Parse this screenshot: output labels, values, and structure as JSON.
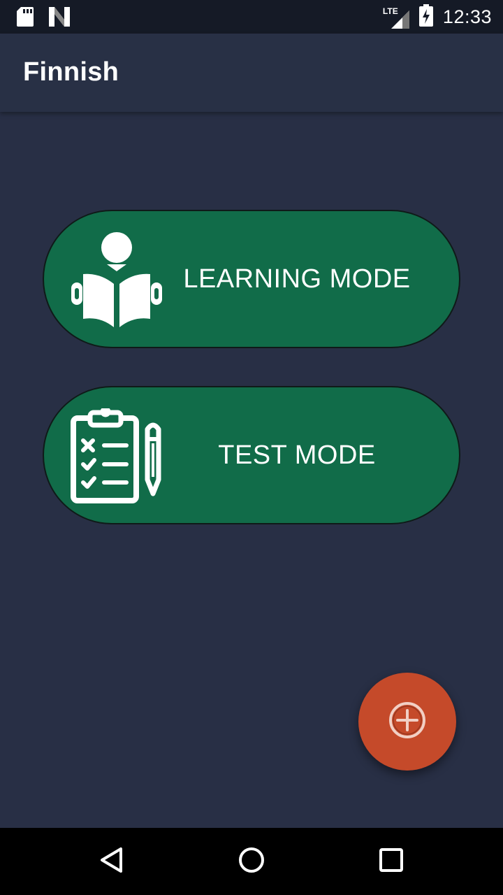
{
  "status_bar": {
    "time": "12:33",
    "network_label": "LTE",
    "icons": [
      "sd-card-icon",
      "n-logo-icon",
      "lte-signal-icon",
      "battery-charging-icon"
    ]
  },
  "app_bar": {
    "title": "Finnish"
  },
  "main": {
    "learning_button": {
      "label": "LEARNING MODE",
      "icon": "reading-person-icon"
    },
    "test_button": {
      "label": "TEST MODE",
      "icon": "checklist-pencil-icon"
    }
  },
  "fab": {
    "icon": "add-circle-icon"
  },
  "nav_bar": {
    "icons": [
      "back-icon",
      "home-icon",
      "recents-icon"
    ]
  },
  "colors": {
    "background": "#282f45",
    "button_green": "#116c49",
    "fab_orange": "#c54a2a",
    "status_bar": "#151a26"
  }
}
